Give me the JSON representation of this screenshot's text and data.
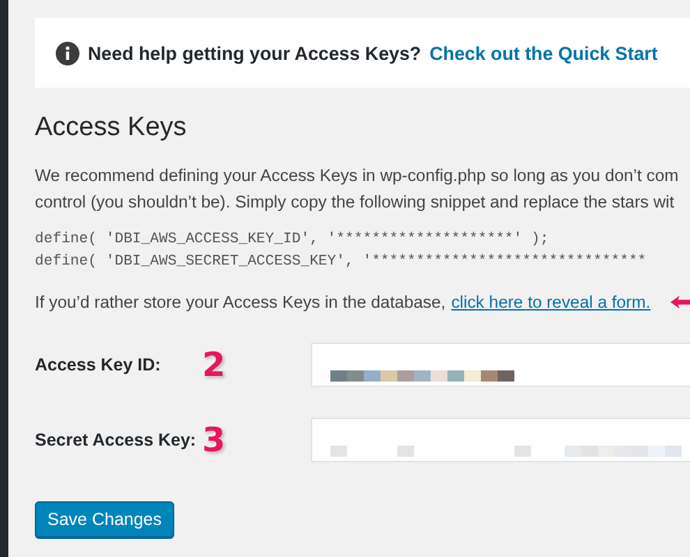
{
  "notice": {
    "text": "Need help getting your Access Keys?",
    "link": "Check out the Quick Start"
  },
  "heading": "Access Keys",
  "intro_lines": [
    "We recommend defining your Access Keys in wp-config.php so long as you don’t com",
    "control (you shouldn’t be). Simply copy the following snippet and replace the stars wit"
  ],
  "code_lines": [
    "define( 'DBI_AWS_ACCESS_KEY_ID', '********************' );",
    "define( 'DBI_AWS_SECRET_ACCESS_KEY', '*******************************"
  ],
  "reveal": {
    "text": "If you’d rather store your Access Keys in the database,",
    "link": "click here to reveal a form."
  },
  "fields": [
    {
      "label": "Access Key ID:",
      "marker": "2"
    },
    {
      "label": "Secret Access Key:",
      "marker": "3"
    }
  ],
  "save_button": "Save Changes"
}
